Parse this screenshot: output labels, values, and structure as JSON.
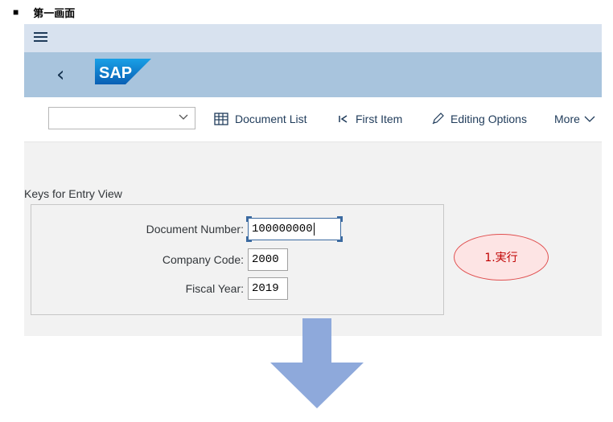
{
  "doc": {
    "bullet": "■",
    "heading": "第一画面"
  },
  "shell": {
    "menu_icon": "hamburger-menu-icon",
    "back_icon": "chevron-left-icon",
    "logo_text": "SAP"
  },
  "toolbar": {
    "variant_value": "",
    "document_list_label": "Document List",
    "first_item_label": "First Item",
    "editing_options_label": "Editing Options",
    "more_label": "More"
  },
  "form": {
    "section_title": "Keys for Entry View",
    "fields": [
      {
        "label": "Document Number:",
        "value": "100000000"
      },
      {
        "label": "Company Code:",
        "value": "2000"
      },
      {
        "label": "Fiscal Year:",
        "value": "2019"
      }
    ]
  },
  "annotation": {
    "callout_text": "1.実行"
  },
  "colors": {
    "shell": "#d8e2ef",
    "header": "#a8c4dd",
    "sap_blue": "#1a6fc4",
    "arrow": "#8ea9db",
    "callout_border": "#e05050"
  }
}
